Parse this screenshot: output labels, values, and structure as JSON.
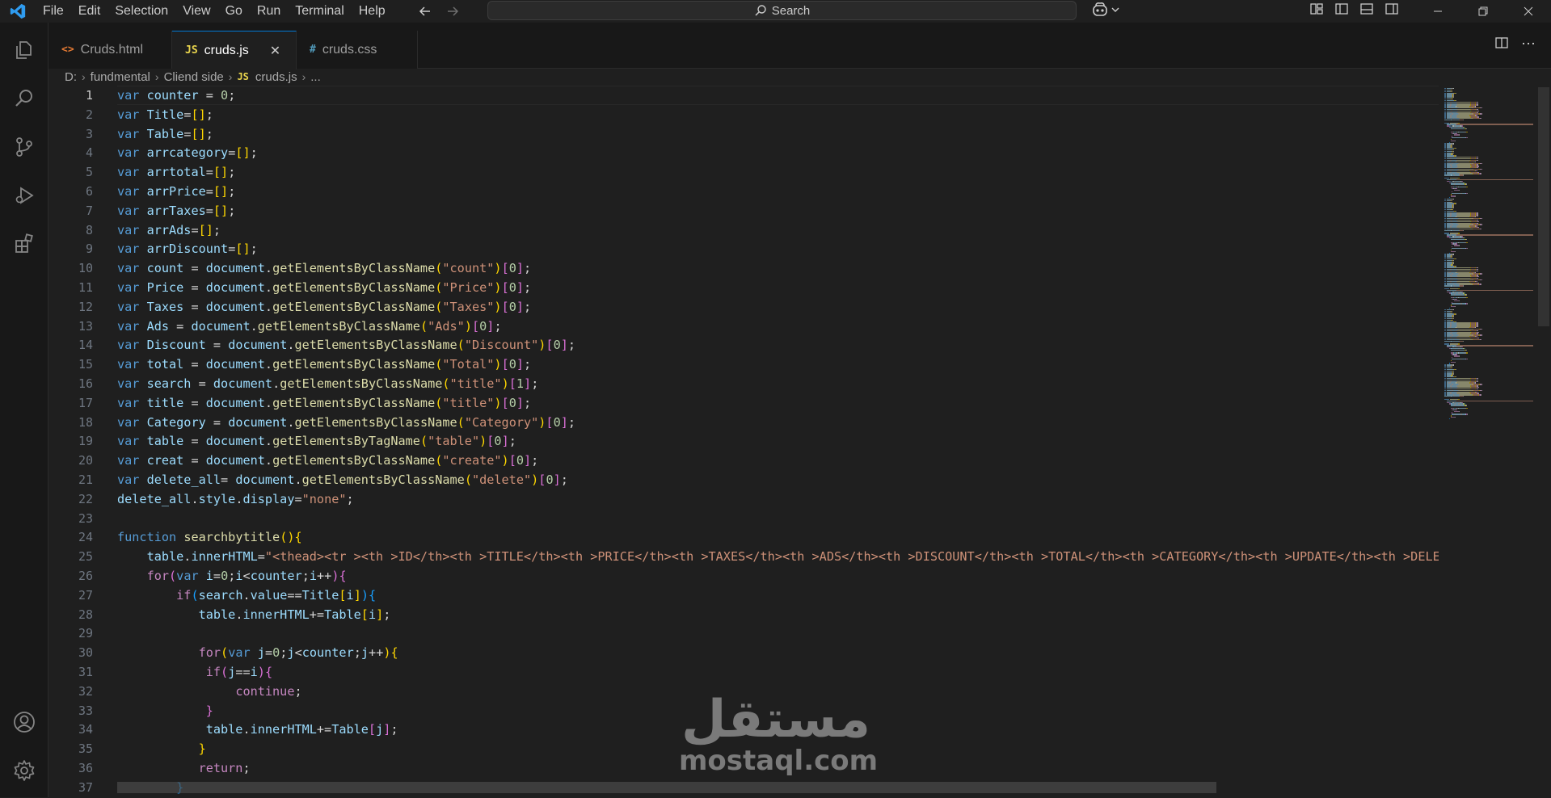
{
  "menu": [
    "File",
    "Edit",
    "Selection",
    "View",
    "Go",
    "Run",
    "Terminal",
    "Help"
  ],
  "search": {
    "label": "Search"
  },
  "tabs": [
    {
      "label": "Cruds.html",
      "glyph": "<>",
      "color": "#e37933"
    },
    {
      "label": "cruds.js",
      "glyph": "JS",
      "color": "#e8d44d",
      "active": true
    },
    {
      "label": "cruds.css",
      "glyph": "#",
      "color": "#519aba"
    }
  ],
  "breadcrumb": {
    "drive": "D:",
    "folder1": "fundmental",
    "folder2": "Cliend side",
    "file_glyph": "JS",
    "file": "cruds.js",
    "more": "..."
  },
  "editor": {
    "current_line": 1,
    "line_numbers": [
      "1",
      "2",
      "3",
      "4",
      "5",
      "6",
      "7",
      "8",
      "9",
      "10",
      "11",
      "12",
      "13",
      "14",
      "15",
      "16",
      "17",
      "18",
      "19",
      "20",
      "21",
      "22",
      "23",
      "24",
      "25",
      "26",
      "27",
      "28",
      "29",
      "30",
      "31",
      "32",
      "33",
      "34",
      "35",
      "36",
      "37"
    ],
    "lines": [
      [
        [
          "kw",
          "var"
        ],
        [
          "pl",
          " "
        ],
        [
          "vr",
          "counter"
        ],
        [
          "pl",
          " = "
        ],
        [
          "nm",
          "0"
        ],
        [
          "pl",
          ";"
        ]
      ],
      [
        [
          "kw",
          "var"
        ],
        [
          "pl",
          " "
        ],
        [
          "vr",
          "Title"
        ],
        [
          "pl",
          "="
        ],
        [
          "bk",
          "[]"
        ],
        [
          "pl",
          ";"
        ]
      ],
      [
        [
          "kw",
          "var"
        ],
        [
          "pl",
          " "
        ],
        [
          "vr",
          "Table"
        ],
        [
          "pl",
          "="
        ],
        [
          "bk",
          "[]"
        ],
        [
          "pl",
          ";"
        ]
      ],
      [
        [
          "kw",
          "var"
        ],
        [
          "pl",
          " "
        ],
        [
          "vr",
          "arrcategory"
        ],
        [
          "pl",
          "="
        ],
        [
          "bk",
          "[]"
        ],
        [
          "pl",
          ";"
        ]
      ],
      [
        [
          "kw",
          "var"
        ],
        [
          "pl",
          " "
        ],
        [
          "vr",
          "arrtotal"
        ],
        [
          "pl",
          "="
        ],
        [
          "bk",
          "[]"
        ],
        [
          "pl",
          ";"
        ]
      ],
      [
        [
          "kw",
          "var"
        ],
        [
          "pl",
          " "
        ],
        [
          "vr",
          "arrPrice"
        ],
        [
          "pl",
          "="
        ],
        [
          "bk",
          "[]"
        ],
        [
          "pl",
          ";"
        ]
      ],
      [
        [
          "kw",
          "var"
        ],
        [
          "pl",
          " "
        ],
        [
          "vr",
          "arrTaxes"
        ],
        [
          "pl",
          "="
        ],
        [
          "bk",
          "[]"
        ],
        [
          "pl",
          ";"
        ]
      ],
      [
        [
          "kw",
          "var"
        ],
        [
          "pl",
          " "
        ],
        [
          "vr",
          "arrAds"
        ],
        [
          "pl",
          "="
        ],
        [
          "bk",
          "[]"
        ],
        [
          "pl",
          ";"
        ]
      ],
      [
        [
          "kw",
          "var"
        ],
        [
          "pl",
          " "
        ],
        [
          "vr",
          "arrDiscount"
        ],
        [
          "pl",
          "="
        ],
        [
          "bk",
          "[]"
        ],
        [
          "pl",
          ";"
        ]
      ],
      [
        [
          "kw",
          "var"
        ],
        [
          "pl",
          " "
        ],
        [
          "vr",
          "count"
        ],
        [
          "pl",
          " = "
        ],
        [
          "vr",
          "document"
        ],
        [
          "pl",
          "."
        ],
        [
          "fn",
          "getElementsByClassName"
        ],
        [
          "bk",
          "("
        ],
        [
          "st",
          "\"count\""
        ],
        [
          "bk",
          ")"
        ],
        [
          "bp",
          "["
        ],
        [
          "nm",
          "0"
        ],
        [
          "bp",
          "]"
        ],
        [
          "pl",
          ";"
        ]
      ],
      [
        [
          "kw",
          "var"
        ],
        [
          "pl",
          " "
        ],
        [
          "vr",
          "Price"
        ],
        [
          "pl",
          " = "
        ],
        [
          "vr",
          "document"
        ],
        [
          "pl",
          "."
        ],
        [
          "fn",
          "getElementsByClassName"
        ],
        [
          "bk",
          "("
        ],
        [
          "st",
          "\"Price\""
        ],
        [
          "bk",
          ")"
        ],
        [
          "bp",
          "["
        ],
        [
          "nm",
          "0"
        ],
        [
          "bp",
          "]"
        ],
        [
          "pl",
          ";"
        ]
      ],
      [
        [
          "kw",
          "var"
        ],
        [
          "pl",
          " "
        ],
        [
          "vr",
          "Taxes"
        ],
        [
          "pl",
          " = "
        ],
        [
          "vr",
          "document"
        ],
        [
          "pl",
          "."
        ],
        [
          "fn",
          "getElementsByClassName"
        ],
        [
          "bk",
          "("
        ],
        [
          "st",
          "\"Taxes\""
        ],
        [
          "bk",
          ")"
        ],
        [
          "bp",
          "["
        ],
        [
          "nm",
          "0"
        ],
        [
          "bp",
          "]"
        ],
        [
          "pl",
          ";"
        ]
      ],
      [
        [
          "kw",
          "var"
        ],
        [
          "pl",
          " "
        ],
        [
          "vr",
          "Ads"
        ],
        [
          "pl",
          " = "
        ],
        [
          "vr",
          "document"
        ],
        [
          "pl",
          "."
        ],
        [
          "fn",
          "getElementsByClassName"
        ],
        [
          "bk",
          "("
        ],
        [
          "st",
          "\"Ads\""
        ],
        [
          "bk",
          ")"
        ],
        [
          "bp",
          "["
        ],
        [
          "nm",
          "0"
        ],
        [
          "bp",
          "]"
        ],
        [
          "pl",
          ";"
        ]
      ],
      [
        [
          "kw",
          "var"
        ],
        [
          "pl",
          " "
        ],
        [
          "vr",
          "Discount"
        ],
        [
          "pl",
          " = "
        ],
        [
          "vr",
          "document"
        ],
        [
          "pl",
          "."
        ],
        [
          "fn",
          "getElementsByClassName"
        ],
        [
          "bk",
          "("
        ],
        [
          "st",
          "\"Discount\""
        ],
        [
          "bk",
          ")"
        ],
        [
          "bp",
          "["
        ],
        [
          "nm",
          "0"
        ],
        [
          "bp",
          "]"
        ],
        [
          "pl",
          ";"
        ]
      ],
      [
        [
          "kw",
          "var"
        ],
        [
          "pl",
          " "
        ],
        [
          "vr",
          "total"
        ],
        [
          "pl",
          " = "
        ],
        [
          "vr",
          "document"
        ],
        [
          "pl",
          "."
        ],
        [
          "fn",
          "getElementsByClassName"
        ],
        [
          "bk",
          "("
        ],
        [
          "st",
          "\"Total\""
        ],
        [
          "bk",
          ")"
        ],
        [
          "bp",
          "["
        ],
        [
          "nm",
          "0"
        ],
        [
          "bp",
          "]"
        ],
        [
          "pl",
          ";"
        ]
      ],
      [
        [
          "kw",
          "var"
        ],
        [
          "pl",
          " "
        ],
        [
          "vr",
          "search"
        ],
        [
          "pl",
          " = "
        ],
        [
          "vr",
          "document"
        ],
        [
          "pl",
          "."
        ],
        [
          "fn",
          "getElementsByClassName"
        ],
        [
          "bk",
          "("
        ],
        [
          "st",
          "\"title\""
        ],
        [
          "bk",
          ")"
        ],
        [
          "bp",
          "["
        ],
        [
          "nm",
          "1"
        ],
        [
          "bp",
          "]"
        ],
        [
          "pl",
          ";"
        ]
      ],
      [
        [
          "kw",
          "var"
        ],
        [
          "pl",
          " "
        ],
        [
          "vr",
          "title"
        ],
        [
          "pl",
          " = "
        ],
        [
          "vr",
          "document"
        ],
        [
          "pl",
          "."
        ],
        [
          "fn",
          "getElementsByClassName"
        ],
        [
          "bk",
          "("
        ],
        [
          "st",
          "\"title\""
        ],
        [
          "bk",
          ")"
        ],
        [
          "bp",
          "["
        ],
        [
          "nm",
          "0"
        ],
        [
          "bp",
          "]"
        ],
        [
          "pl",
          ";"
        ]
      ],
      [
        [
          "kw",
          "var"
        ],
        [
          "pl",
          " "
        ],
        [
          "vr",
          "Category"
        ],
        [
          "pl",
          " = "
        ],
        [
          "vr",
          "document"
        ],
        [
          "pl",
          "."
        ],
        [
          "fn",
          "getElementsByClassName"
        ],
        [
          "bk",
          "("
        ],
        [
          "st",
          "\"Category\""
        ],
        [
          "bk",
          ")"
        ],
        [
          "bp",
          "["
        ],
        [
          "nm",
          "0"
        ],
        [
          "bp",
          "]"
        ],
        [
          "pl",
          ";"
        ]
      ],
      [
        [
          "kw",
          "var"
        ],
        [
          "pl",
          " "
        ],
        [
          "vr",
          "table"
        ],
        [
          "pl",
          " = "
        ],
        [
          "vr",
          "document"
        ],
        [
          "pl",
          "."
        ],
        [
          "fn",
          "getElementsByTagName"
        ],
        [
          "bk",
          "("
        ],
        [
          "st",
          "\"table\""
        ],
        [
          "bk",
          ")"
        ],
        [
          "bp",
          "["
        ],
        [
          "nm",
          "0"
        ],
        [
          "bp",
          "]"
        ],
        [
          "pl",
          ";"
        ]
      ],
      [
        [
          "kw",
          "var"
        ],
        [
          "pl",
          " "
        ],
        [
          "vr",
          "creat"
        ],
        [
          "pl",
          " = "
        ],
        [
          "vr",
          "document"
        ],
        [
          "pl",
          "."
        ],
        [
          "fn",
          "getElementsByClassName"
        ],
        [
          "bk",
          "("
        ],
        [
          "st",
          "\"create\""
        ],
        [
          "bk",
          ")"
        ],
        [
          "bp",
          "["
        ],
        [
          "nm",
          "0"
        ],
        [
          "bp",
          "]"
        ],
        [
          "pl",
          ";"
        ]
      ],
      [
        [
          "kw",
          "var"
        ],
        [
          "pl",
          " "
        ],
        [
          "vr",
          "delete_all"
        ],
        [
          "pl",
          "= "
        ],
        [
          "vr",
          "document"
        ],
        [
          "pl",
          "."
        ],
        [
          "fn",
          "getElementsByClassName"
        ],
        [
          "bk",
          "("
        ],
        [
          "st",
          "\"delete\""
        ],
        [
          "bk",
          ")"
        ],
        [
          "bp",
          "["
        ],
        [
          "nm",
          "0"
        ],
        [
          "bp",
          "]"
        ],
        [
          "pl",
          ";"
        ]
      ],
      [
        [
          "vr",
          "delete_all"
        ],
        [
          "pl",
          "."
        ],
        [
          "vr",
          "style"
        ],
        [
          "pl",
          "."
        ],
        [
          "vr",
          "display"
        ],
        [
          "pl",
          "="
        ],
        [
          "st",
          "\"none\""
        ],
        [
          "pl",
          ";"
        ]
      ],
      [],
      [
        [
          "kw",
          "function"
        ],
        [
          "pl",
          " "
        ],
        [
          "fn",
          "searchbytitle"
        ],
        [
          "bk",
          "(){"
        ]
      ],
      [
        [
          "pl",
          "    "
        ],
        [
          "vr",
          "table"
        ],
        [
          "pl",
          "."
        ],
        [
          "vr",
          "innerHTML"
        ],
        [
          "pl",
          "="
        ],
        [
          "st",
          "\"<thead><tr ><th >ID</th><th >TITLE</th><th >PRICE</th><th >TAXES</th><th >ADS</th><th >DISCOUNT</th><th >TOTAL</th><th >CATEGORY</th><th >UPDATE</th><th >DELETE</th></tr></thead>\""
        ]
      ],
      [
        [
          "pl",
          "    "
        ],
        [
          "ct",
          "for"
        ],
        [
          "bp",
          "("
        ],
        [
          "kw",
          "var"
        ],
        [
          "pl",
          " "
        ],
        [
          "vr",
          "i"
        ],
        [
          "pl",
          "="
        ],
        [
          "nm",
          "0"
        ],
        [
          "pl",
          ";"
        ],
        [
          "vr",
          "i"
        ],
        [
          "pl",
          "<"
        ],
        [
          "vr",
          "counter"
        ],
        [
          "pl",
          ";"
        ],
        [
          "vr",
          "i"
        ],
        [
          "pl",
          "++"
        ],
        [
          "bp",
          "){"
        ]
      ],
      [
        [
          "pl",
          "        "
        ],
        [
          "ct",
          "if"
        ],
        [
          "bb",
          "("
        ],
        [
          "vr",
          "search"
        ],
        [
          "pl",
          "."
        ],
        [
          "vr",
          "value"
        ],
        [
          "pl",
          "=="
        ],
        [
          "vr",
          "Title"
        ],
        [
          "bk",
          "["
        ],
        [
          "vr",
          "i"
        ],
        [
          "bk",
          "]"
        ],
        [
          "bb",
          "){"
        ]
      ],
      [
        [
          "pl",
          "           "
        ],
        [
          "vr",
          "table"
        ],
        [
          "pl",
          "."
        ],
        [
          "vr",
          "innerHTML"
        ],
        [
          "pl",
          "+="
        ],
        [
          "vr",
          "Table"
        ],
        [
          "bk",
          "["
        ],
        [
          "vr",
          "i"
        ],
        [
          "bk",
          "]"
        ],
        [
          "pl",
          ";"
        ]
      ],
      [],
      [
        [
          "pl",
          "           "
        ],
        [
          "ct",
          "for"
        ],
        [
          "bk",
          "("
        ],
        [
          "kw",
          "var"
        ],
        [
          "pl",
          " "
        ],
        [
          "vr",
          "j"
        ],
        [
          "pl",
          "="
        ],
        [
          "nm",
          "0"
        ],
        [
          "pl",
          ";"
        ],
        [
          "vr",
          "j"
        ],
        [
          "pl",
          "<"
        ],
        [
          "vr",
          "counter"
        ],
        [
          "pl",
          ";"
        ],
        [
          "vr",
          "j"
        ],
        [
          "pl",
          "++"
        ],
        [
          "bk",
          "){"
        ]
      ],
      [
        [
          "pl",
          "            "
        ],
        [
          "ct",
          "if"
        ],
        [
          "bp",
          "("
        ],
        [
          "vr",
          "j"
        ],
        [
          "pl",
          "=="
        ],
        [
          "vr",
          "i"
        ],
        [
          "bp",
          "){"
        ]
      ],
      [
        [
          "pl",
          "                "
        ],
        [
          "ct",
          "continue"
        ],
        [
          "pl",
          ";"
        ]
      ],
      [
        [
          "pl",
          "            "
        ],
        [
          "bp",
          "}"
        ]
      ],
      [
        [
          "pl",
          "            "
        ],
        [
          "vr",
          "table"
        ],
        [
          "pl",
          "."
        ],
        [
          "vr",
          "innerHTML"
        ],
        [
          "pl",
          "+="
        ],
        [
          "vr",
          "Table"
        ],
        [
          "bp",
          "["
        ],
        [
          "vr",
          "j"
        ],
        [
          "bp",
          "]"
        ],
        [
          "pl",
          ";"
        ]
      ],
      [
        [
          "pl",
          "           "
        ],
        [
          "bk",
          "}"
        ]
      ],
      [
        [
          "pl",
          "           "
        ],
        [
          "ct",
          "return"
        ],
        [
          "pl",
          ";"
        ]
      ],
      [
        [
          "pl",
          "        "
        ],
        [
          "bb",
          "}"
        ]
      ]
    ]
  },
  "watermark": {
    "arabic": "مستقل",
    "latin": "mostaql.com"
  }
}
